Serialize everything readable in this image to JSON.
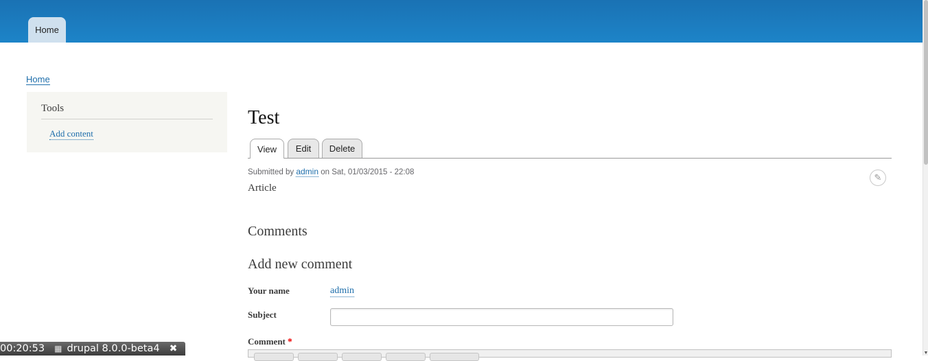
{
  "header": {
    "nav": [
      {
        "label": "Home"
      }
    ]
  },
  "breadcrumb": {
    "home": "Home"
  },
  "sidebar": {
    "title": "Tools",
    "link": "Add content"
  },
  "node": {
    "title": "Test",
    "tabs": [
      {
        "label": "View",
        "active": true
      },
      {
        "label": "Edit"
      },
      {
        "label": "Delete"
      }
    ],
    "submitted_prefix": "Submitted by",
    "author": "admin",
    "submitted_suffix": "on Sat, 01/03/2015 - 22:08",
    "type": "Article"
  },
  "comments": {
    "heading": "Comments",
    "add_heading": "Add new comment",
    "name_label": "Your name",
    "name_value": "admin",
    "subject_label": "Subject",
    "subject_value": "",
    "comment_label": "Comment",
    "required_marker": "*"
  },
  "status_bar": {
    "time": "00:20:53",
    "title": "drupal 8.0.0-beta4",
    "qr_icon": "qr-code-icon",
    "close_icon": "close-icon"
  },
  "colors": {
    "header": "#1d7fc3",
    "link": "#1e6eab",
    "sidebar_bg": "#f6f6f2"
  }
}
